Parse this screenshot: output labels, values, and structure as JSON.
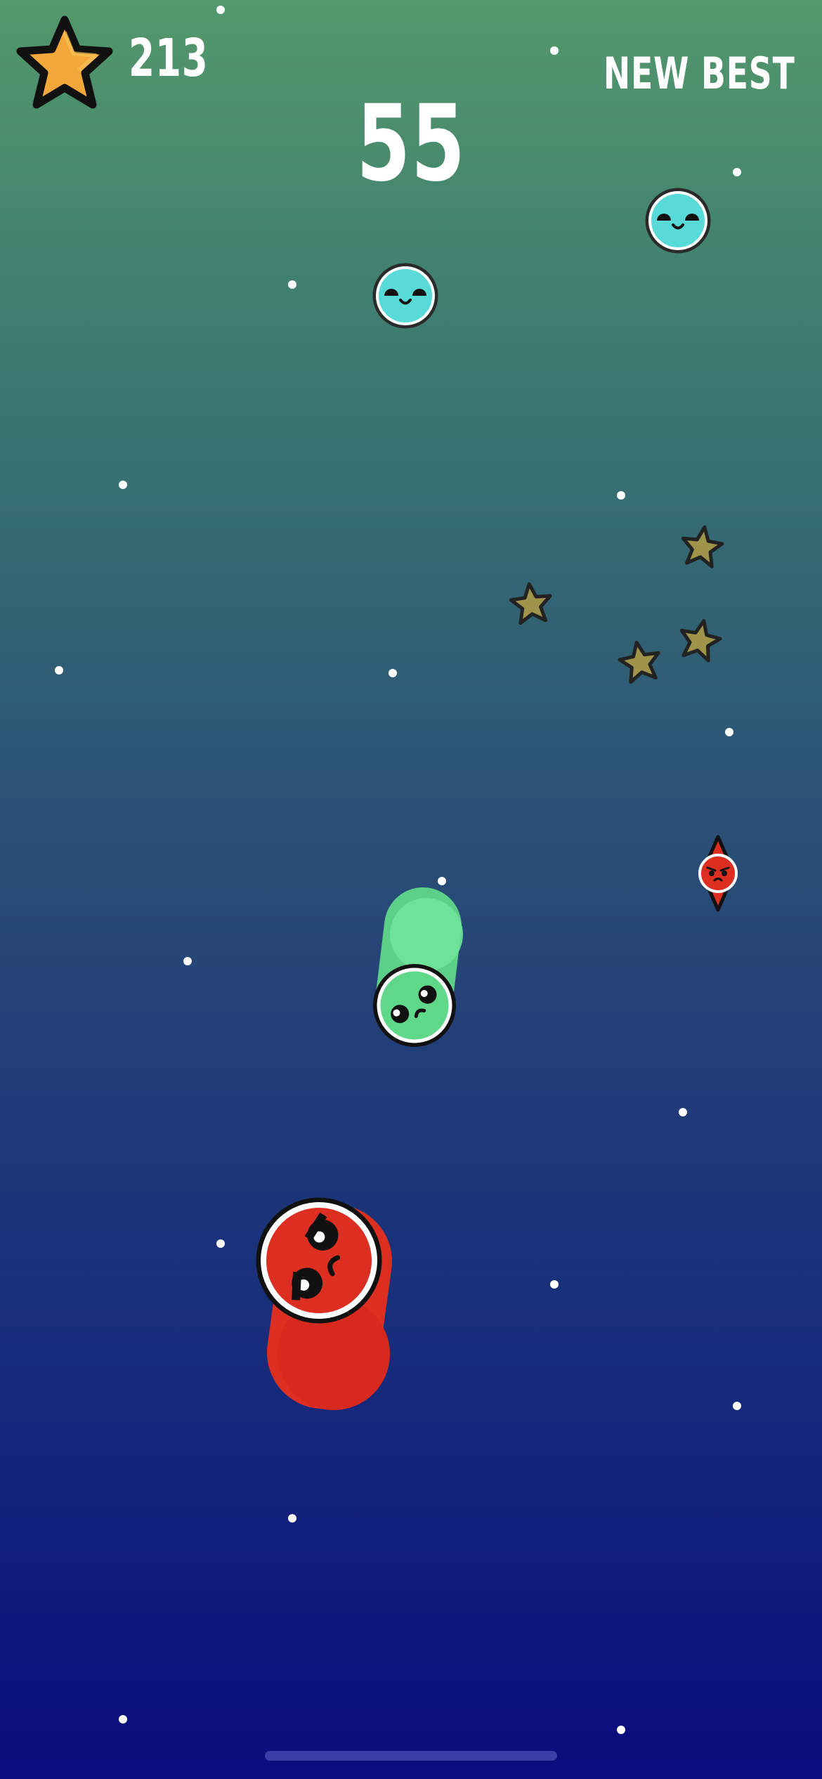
{
  "hud": {
    "star_count": "213",
    "score": "55",
    "status_text": "NEW BEST"
  },
  "icons": {
    "hud_star": "star-icon",
    "collectible": "star-icon",
    "friendly_blob": "smiling-cyan-blob-icon",
    "enemy": "angry-red-spiky-icon",
    "player": "green-blob-snake",
    "boss": "red-blob-snake"
  },
  "colors": {
    "background_top": "#53986c",
    "background_bottom": "#0a0c7d",
    "hud_star_fill": "#f3a93a",
    "cyan_blob": "#58dbd8",
    "player_green": "#5fd88a",
    "enemy_red": "#dd2e22",
    "collectible_star": "#a0944a"
  }
}
